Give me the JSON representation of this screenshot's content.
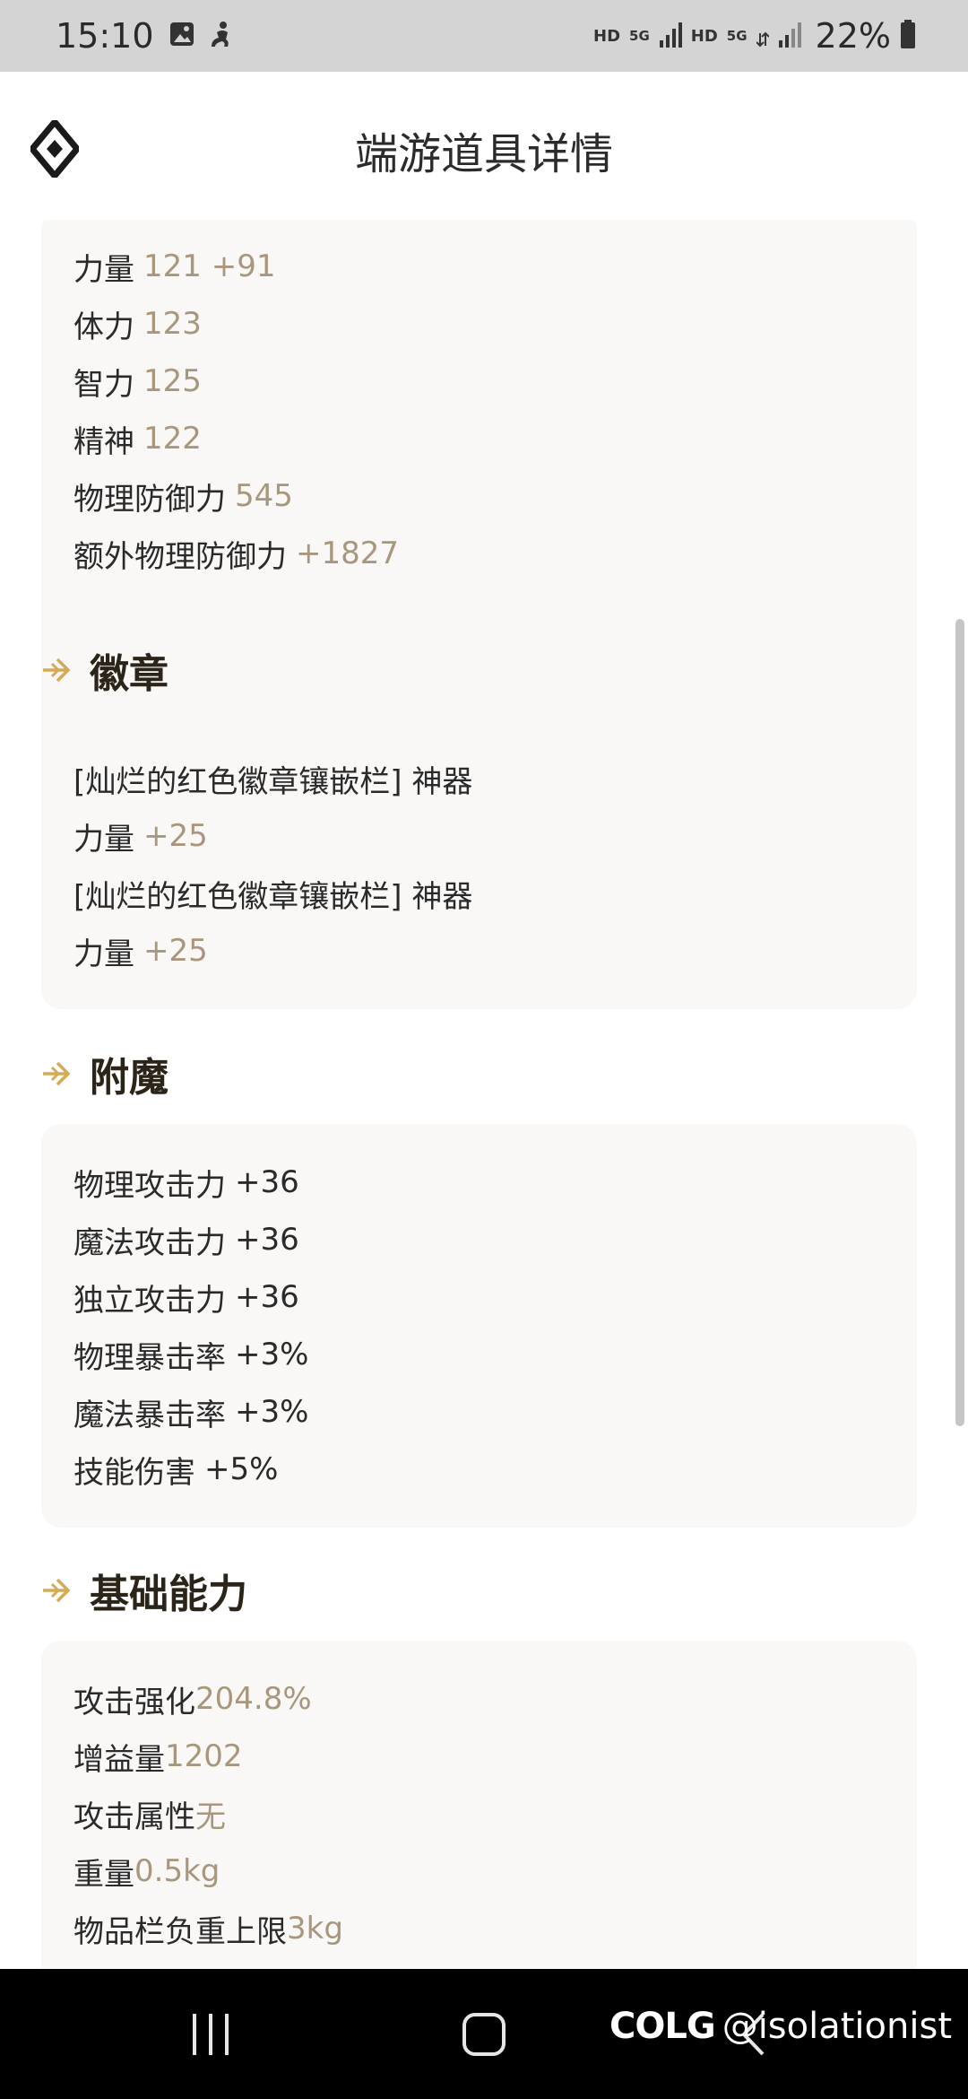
{
  "status_bar": {
    "time": "15:10",
    "icons": [
      "gallery-icon",
      "accessibility-icon"
    ],
    "hd1": "HD",
    "net1": "5G",
    "hd2": "HD",
    "net2": "5G",
    "battery_percent": "22%"
  },
  "header": {
    "title": "端游道具详情"
  },
  "stats_card": {
    "rows": [
      {
        "label": "力量",
        "value": "121 +91"
      },
      {
        "label": "体力",
        "value": "123"
      },
      {
        "label": "智力",
        "value": "125"
      },
      {
        "label": "精神",
        "value": "122"
      },
      {
        "label": "物理防御力",
        "value": "545"
      },
      {
        "label": "额外物理防御力",
        "value": "+1827"
      }
    ]
  },
  "emblem_section": {
    "title": "徽章",
    "rows": [
      {
        "label": "[灿烂的红色徽章镶嵌栏] 神器",
        "value": ""
      },
      {
        "label": "力量",
        "value": "+25"
      },
      {
        "label": "[灿烂的红色徽章镶嵌栏] 神器",
        "value": ""
      },
      {
        "label": "力量",
        "value": "+25"
      }
    ]
  },
  "enchant_section": {
    "title": "附魔",
    "rows": [
      {
        "label": "物理攻击力",
        "value": "+36"
      },
      {
        "label": "魔法攻击力",
        "value": "+36"
      },
      {
        "label": "独立攻击力",
        "value": "+36"
      },
      {
        "label": "物理暴击率",
        "value": "+3%"
      },
      {
        "label": "魔法暴击率",
        "value": "+3%"
      },
      {
        "label": "技能伤害",
        "value": "+5%"
      }
    ]
  },
  "base_section": {
    "title": "基础能力",
    "rows": [
      {
        "label": "攻击强化",
        "value": "204.8%"
      },
      {
        "label": "增益量",
        "value": "1202"
      },
      {
        "label": "攻击属性",
        "value": "无"
      },
      {
        "label": "重量",
        "value": "0.5kg"
      },
      {
        "label": "物品栏负重上限",
        "value": "3kg"
      }
    ]
  },
  "watermark": {
    "logo": "COLG",
    "user": "@isolationist"
  },
  "colors": {
    "accent_gold": "#d4aa57",
    "value_text": "#a8977c",
    "card_bg": "#f9f8f7"
  }
}
